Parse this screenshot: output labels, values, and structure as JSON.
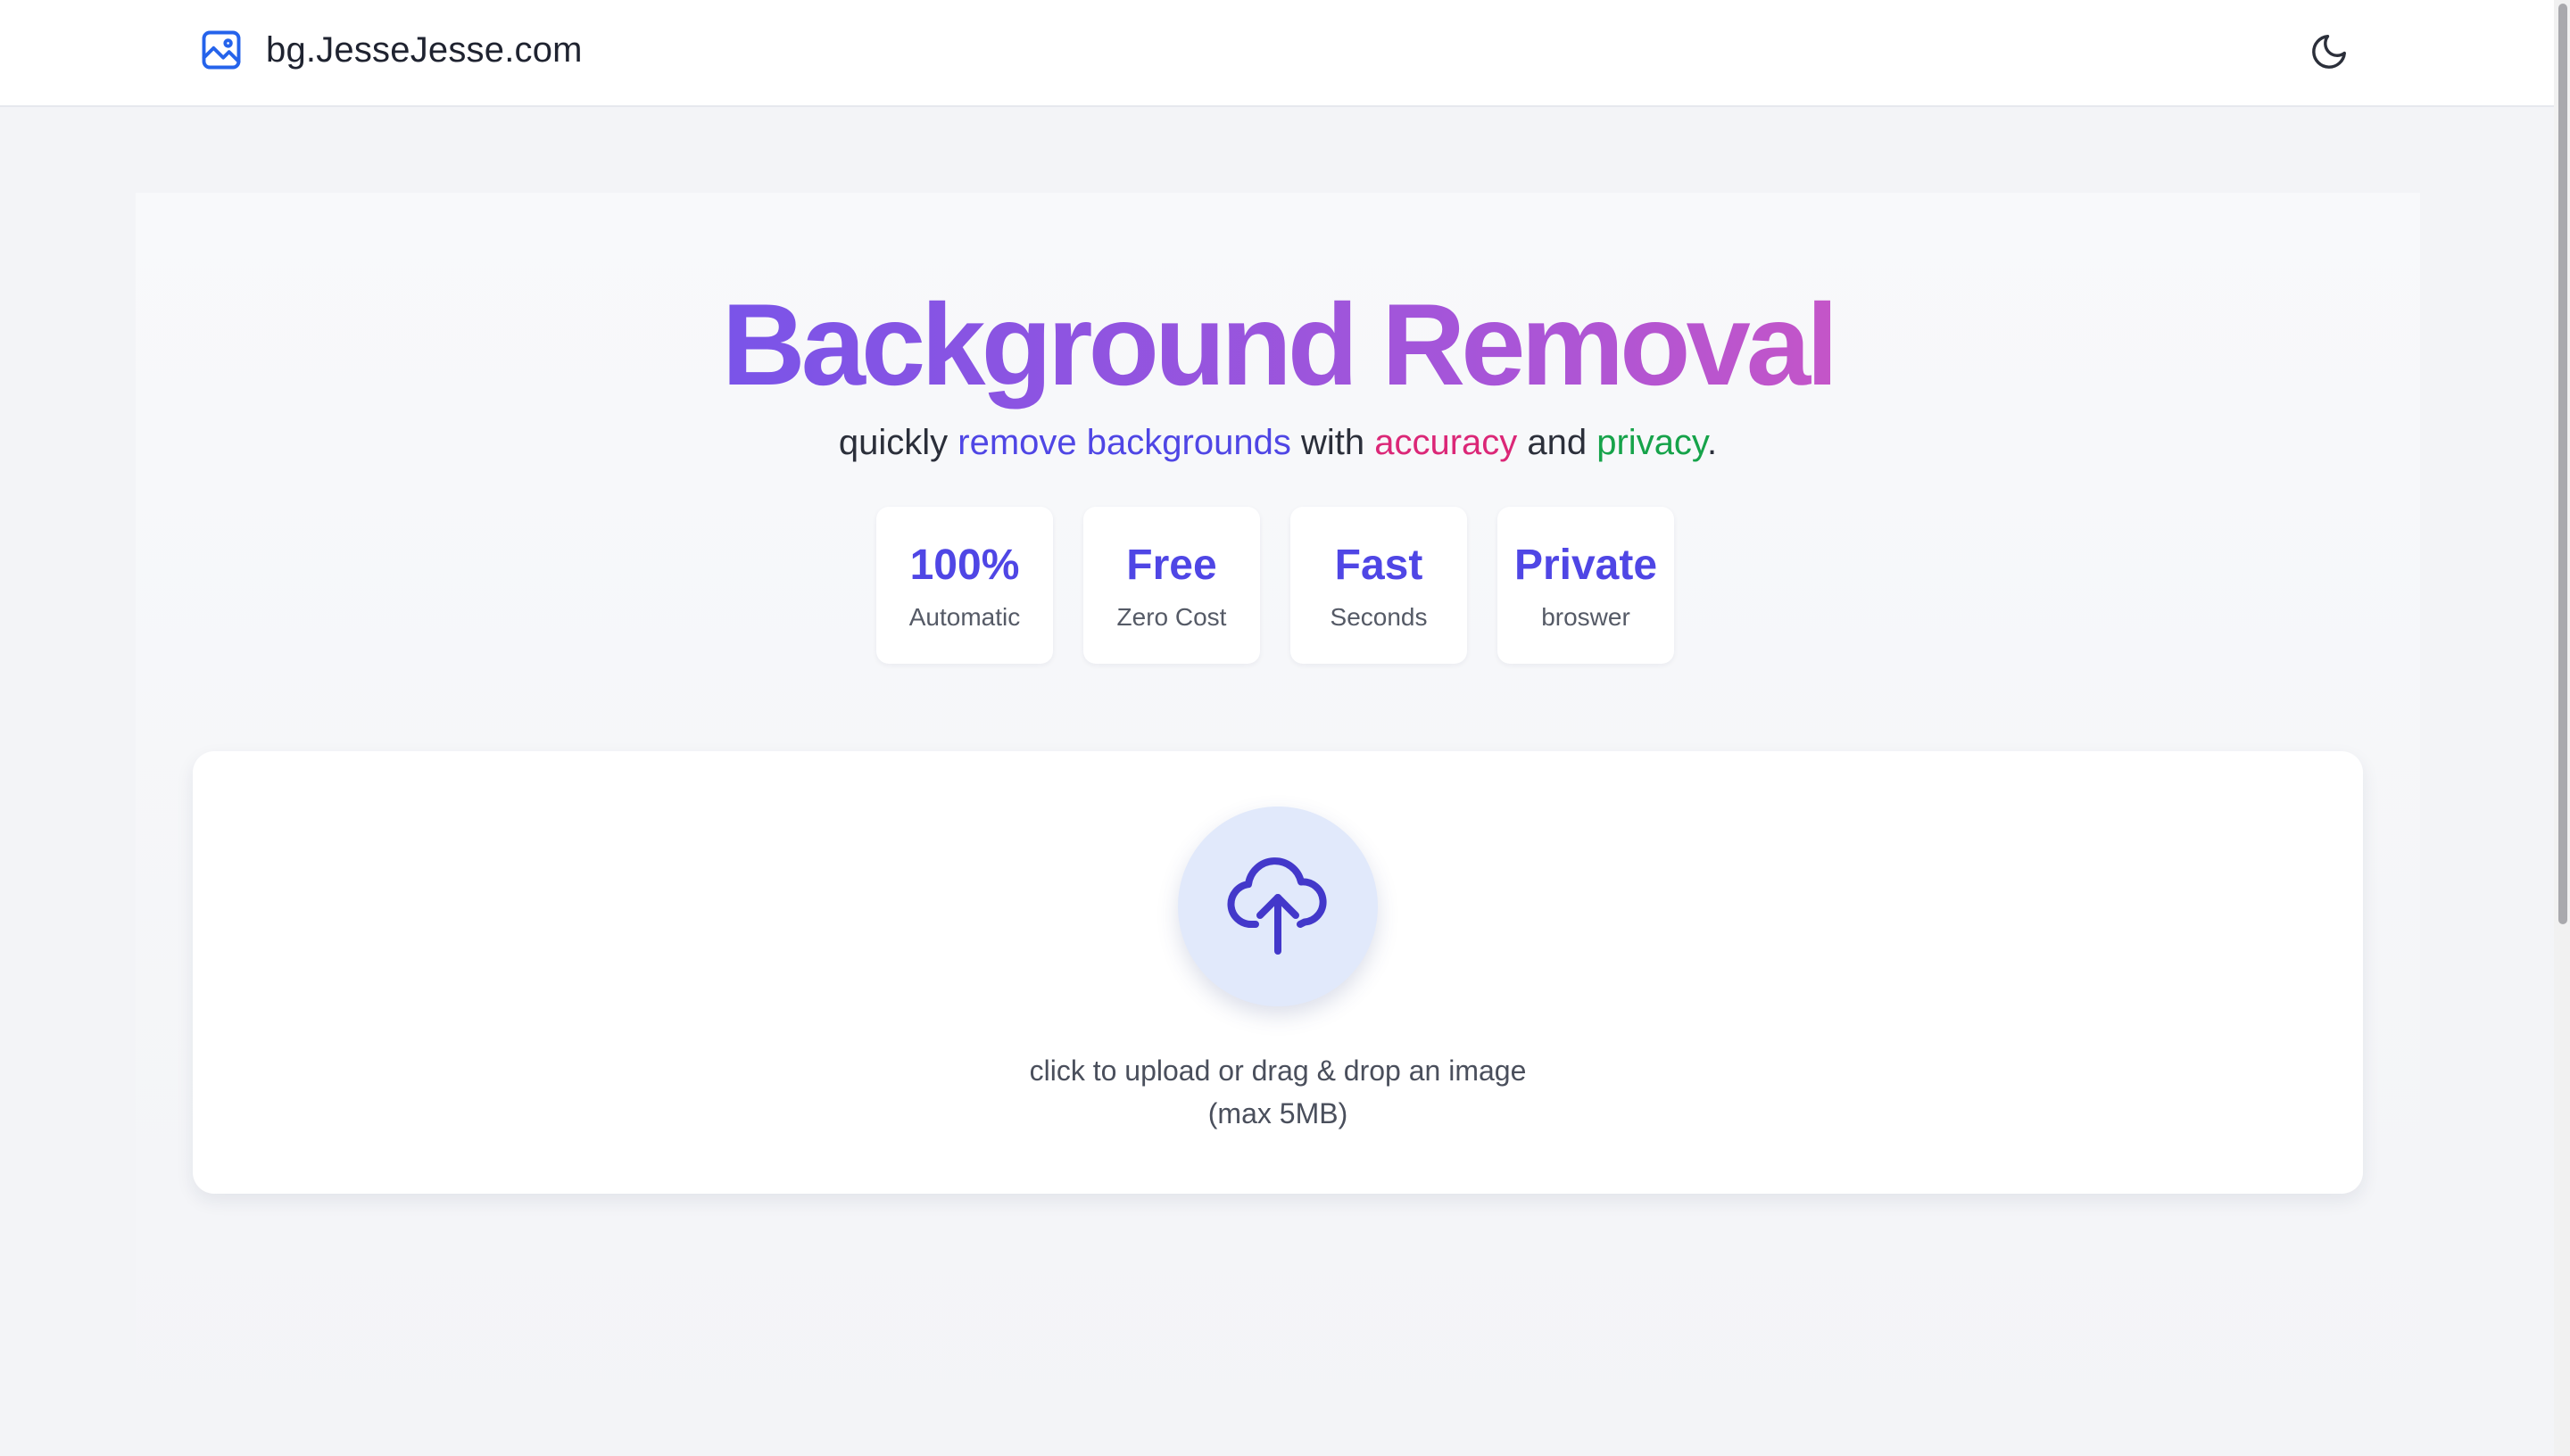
{
  "header": {
    "site_name": "bg.JesseJesse.com",
    "logo_icon": "image-icon",
    "theme_toggle_icon": "moon-icon"
  },
  "hero": {
    "title": "Background Removal",
    "subtitle": {
      "part1": "quickly ",
      "highlight1": "remove backgrounds",
      "part2": " with ",
      "highlight2": "accuracy",
      "part3": " and ",
      "highlight3": "privacy",
      "part4": "."
    }
  },
  "stats": [
    {
      "value": "100%",
      "label": "Automatic"
    },
    {
      "value": "Free",
      "label": "Zero Cost"
    },
    {
      "value": "Fast",
      "label": "Seconds"
    },
    {
      "value": "Private",
      "label": "broswer"
    }
  ],
  "upload": {
    "icon": "cloud-upload-icon",
    "line1": "click to upload or drag & drop an image",
    "line2": "(max 5MB)"
  },
  "colors": {
    "accent": "#4f46e5",
    "pink": "#db2777",
    "green": "#16a34a",
    "title_gradient_start": "#7a54e8",
    "title_gradient_end": "#c455c8"
  }
}
